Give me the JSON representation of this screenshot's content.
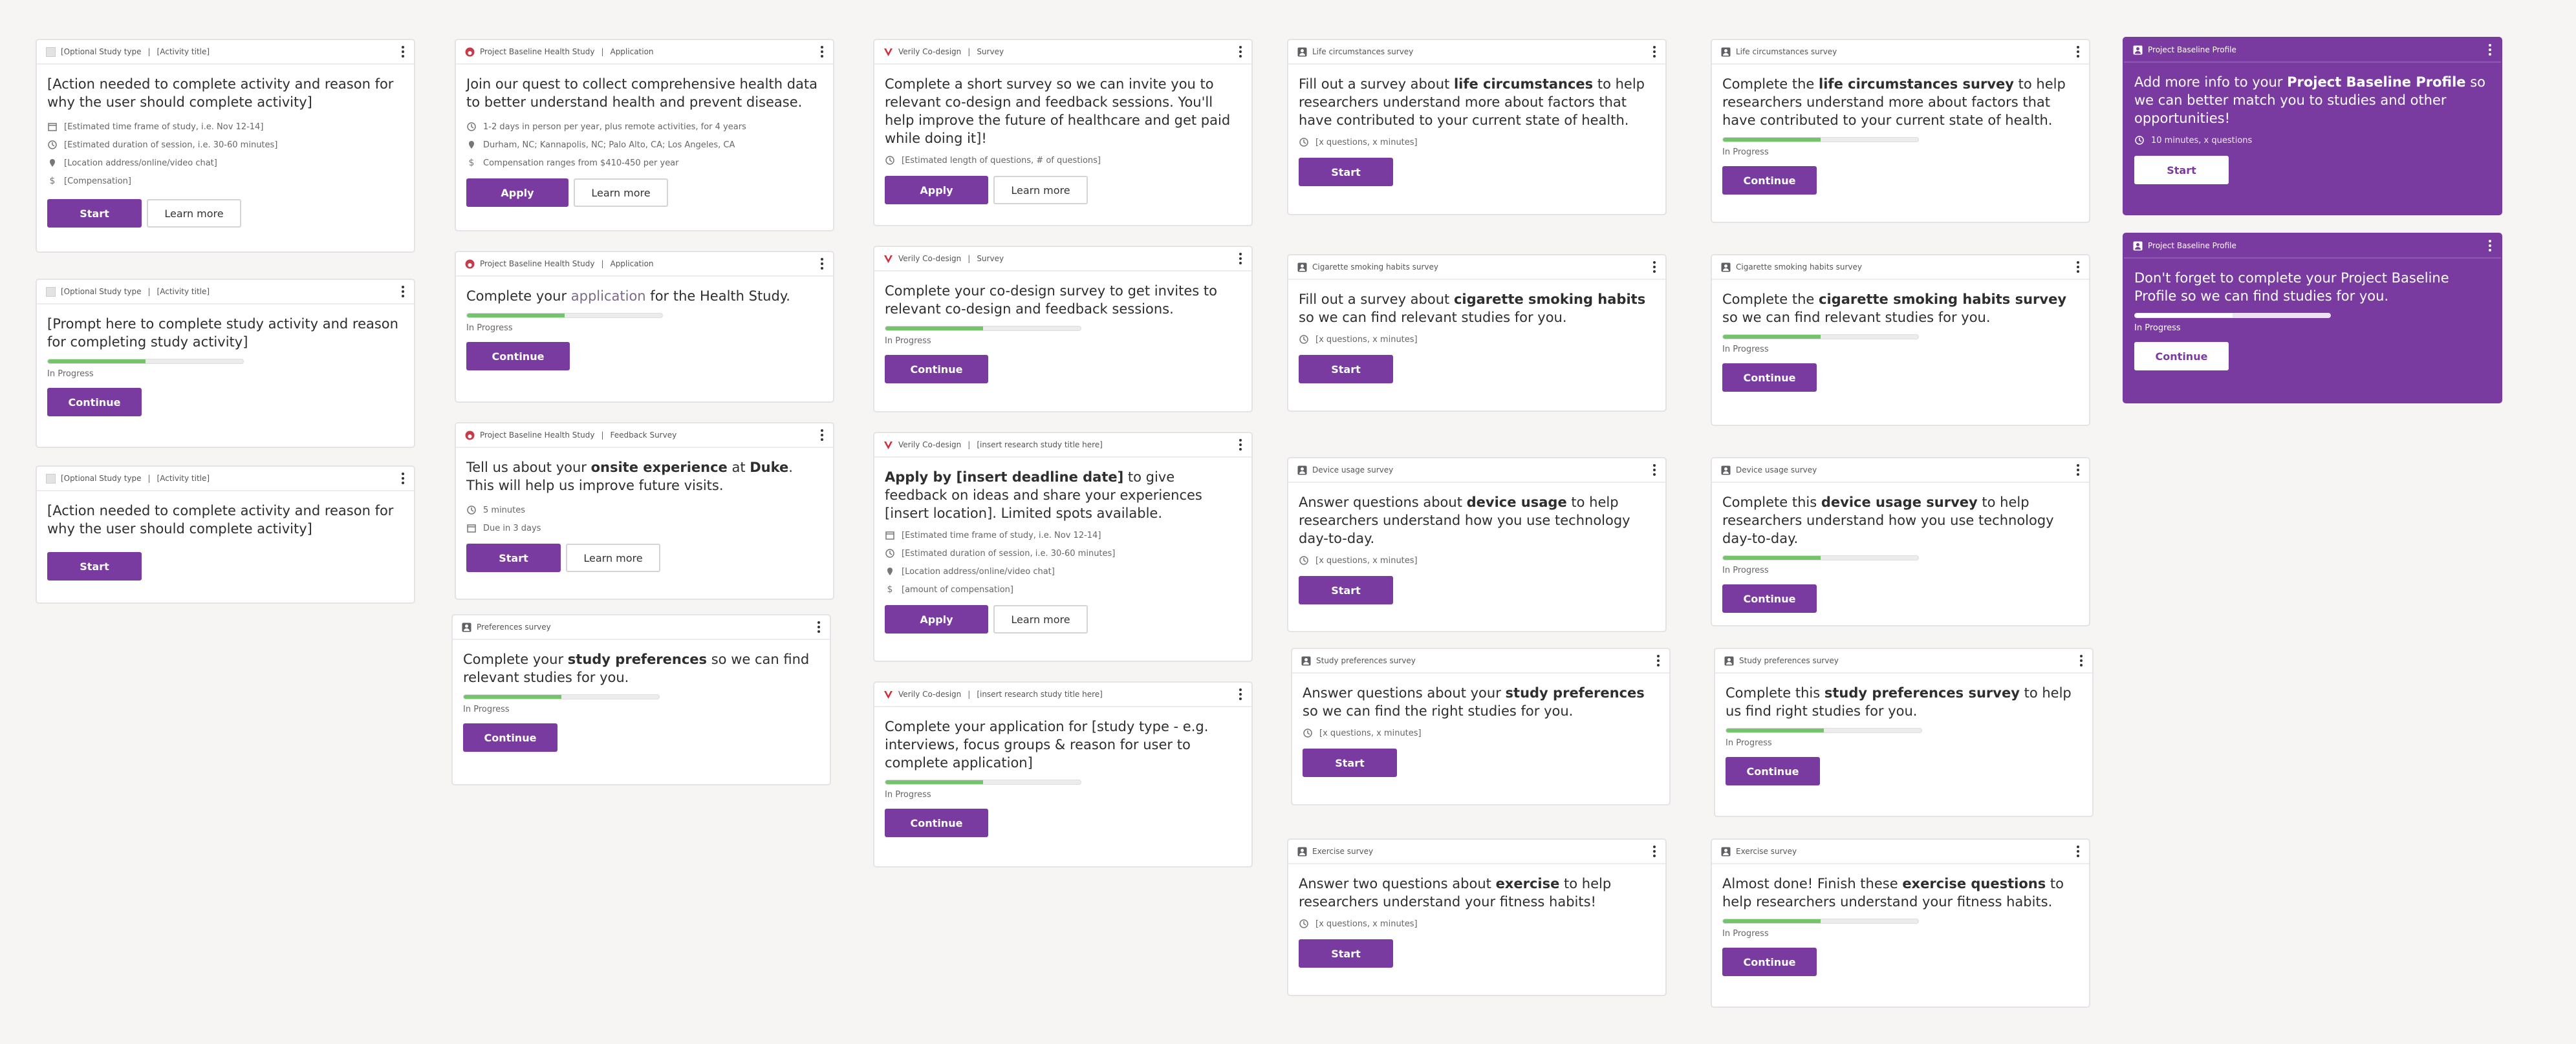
{
  "cards": [
    {
      "header": [
        "[Optional Study type",
        "[Activity title]"
      ],
      "title": "[Action needed to complete activity and reason for why the user should complete activity]",
      "meta": [
        "[Estimated time frame of study, i.e. Nov 12-14]",
        "[Estimated duration of session, i.e. 30-60 minutes]",
        "[Location address/online/video chat]",
        "[Compensation]"
      ],
      "buttons": [
        "Start",
        "Learn more"
      ]
    },
    {
      "header": [
        "[Optional Study type",
        "[Activity title]"
      ],
      "title": "[Prompt here to complete study activity and reason for completing study activity]",
      "progress_label": "In Progress",
      "progress": 0.5,
      "buttons": [
        "Continue"
      ]
    },
    {
      "header": [
        "[Optional Study type",
        "[Activity title]"
      ],
      "title": "[Action needed to complete activity and reason for why the user should complete activity]",
      "buttons": [
        "Start"
      ]
    },
    {
      "header": [
        "Project Baseline Health Study",
        "Application"
      ],
      "title": "Join our quest to collect comprehensive health data to better understand health and prevent disease.",
      "meta": [
        "1-2 days in person per year, plus remote activities, for 4 years",
        "Durham, NC; Kannapolis, NC; Palo Alto, CA; Los Angeles, CA",
        "Compensation ranges from $410-450 per year"
      ],
      "buttons": [
        "Apply",
        "Learn more"
      ]
    },
    {
      "header": [
        "Project Baseline Health Study",
        "Application"
      ],
      "title_parts": [
        "Complete your ",
        "application",
        " for the Health Study."
      ],
      "progress_label": "In Progress",
      "progress": 0.5,
      "buttons": [
        "Continue"
      ]
    },
    {
      "header": [
        "Project Baseline Health Study",
        "Feedback Survey"
      ],
      "title_parts": [
        "Tell us about your ",
        "onsite experience",
        " at ",
        "Duke",
        ". This will help us improve future visits."
      ],
      "meta": [
        "5 minutes",
        "Due in 3 days"
      ],
      "buttons": [
        "Start",
        "Learn more"
      ]
    },
    {
      "header": [
        "Preferences survey"
      ],
      "title_parts": [
        "Complete your ",
        "study preferences",
        " so we can find relevant studies for you."
      ],
      "progress_label": "In Progress",
      "progress": 0.5,
      "buttons": [
        "Continue"
      ]
    },
    {
      "header": [
        "Verily Co-design",
        "Survey"
      ],
      "title": "Complete a short survey so we can invite you to relevant co-design and feedback sessions. You'll help improve the future of healthcare and get paid while doing it]!",
      "meta": [
        "[Estimated length of questions, # of questions]"
      ],
      "buttons": [
        "Apply",
        "Learn more"
      ]
    },
    {
      "header": [
        "Verily Co-design",
        "Survey"
      ],
      "title": "Complete your co-design survey to get invites to relevant co-design and feedback sessions.",
      "progress_label": "In Progress",
      "progress": 0.5,
      "buttons": [
        "Continue"
      ]
    },
    {
      "header": [
        "Verily Co-design",
        "[insert research study title here]"
      ],
      "title_parts": [
        "Apply by [insert deadline date]",
        " to give feedback on ideas and share your experiences [insert location]. Limited spots available."
      ],
      "meta": [
        "[Estimated time frame of study, i.e. Nov 12-14]",
        "[Estimated duration of session, i.e. 30-60 minutes]",
        "[Location address/online/video chat]",
        "[amount of compensation]"
      ],
      "buttons": [
        "Apply",
        "Learn more"
      ]
    },
    {
      "header": [
        "Verily Co-design",
        "[insert research study title here]"
      ],
      "title": "Complete your application for [study type - e.g. interviews, focus groups & reason for user to complete application]",
      "progress_label": "In Progress",
      "progress": 0.5,
      "buttons": [
        "Continue"
      ]
    },
    {
      "header": [
        "Life circumstances survey"
      ],
      "title_parts": [
        "Fill out a survey about ",
        "life circumstances",
        " to help researchers understand more about factors that have contributed to your current state of health."
      ],
      "meta": [
        "[x questions, x minutes]"
      ],
      "buttons": [
        "Start"
      ]
    },
    {
      "header": [
        "Cigarette smoking habits survey"
      ],
      "title_parts": [
        "Fill out a survey about ",
        "cigarette smoking habits",
        " so we can find relevant studies for you."
      ],
      "meta": [
        "[x questions, x minutes]"
      ],
      "buttons": [
        "Start"
      ]
    },
    {
      "header": [
        "Device usage survey"
      ],
      "title_parts": [
        "Answer questions about ",
        "device usage",
        " to help researchers understand how you use technology day-to-day."
      ],
      "meta": [
        "[x questions, x minutes]"
      ],
      "buttons": [
        "Start"
      ]
    },
    {
      "header": [
        "Study preferences survey"
      ],
      "title_parts": [
        "Answer questions about your ",
        "study preferences",
        " so we can find the right studies for you."
      ],
      "meta": [
        "[x questions, x minutes]"
      ],
      "buttons": [
        "Start"
      ]
    },
    {
      "header": [
        "Exercise survey"
      ],
      "title_parts": [
        "Answer two questions about ",
        "exercise",
        " to help researchers understand your fitness habits!"
      ],
      "meta": [
        "[x questions, x minutes]"
      ],
      "buttons": [
        "Start"
      ]
    },
    {
      "header": [
        "Life circumstances survey"
      ],
      "title_parts": [
        "Complete the ",
        "life circumstances survey",
        " to help researchers understand more about factors that have contributed to your current state of health."
      ],
      "progress_label": "In Progress",
      "progress": 0.5,
      "buttons": [
        "Continue"
      ]
    },
    {
      "header": [
        "Cigarette smoking habits survey"
      ],
      "title_parts": [
        "Complete the ",
        "cigarette smoking habits survey",
        " so we can find relevant studies for you."
      ],
      "progress_label": "In Progress",
      "progress": 0.5,
      "buttons": [
        "Continue"
      ]
    },
    {
      "header": [
        "Device usage survey"
      ],
      "title_parts": [
        "Complete this ",
        "device usage survey",
        " to help researchers understand how you use technology day-to-day."
      ],
      "progress_label": "In Progress",
      "progress": 0.5,
      "buttons": [
        "Continue"
      ]
    },
    {
      "header": [
        "Study preferences survey"
      ],
      "title_parts": [
        "Complete this ",
        "study preferences survey",
        " to help us find right studies for you."
      ],
      "progress_label": "In Progress",
      "progress": 0.5,
      "buttons": [
        "Continue"
      ]
    },
    {
      "header": [
        "Exercise survey"
      ],
      "title_parts": [
        "Almost done! Finish these ",
        "exercise questions",
        " to help researchers understand your fitness habits."
      ],
      "progress_label": "In Progress",
      "progress": 0.5,
      "buttons": [
        "Continue"
      ]
    },
    {
      "header": [
        "Project Baseline Profile"
      ],
      "title_parts": [
        "Add more info to your ",
        "Project Baseline Profile",
        " so we can better match you to studies and other opportunities!"
      ],
      "meta": [
        "10 minutes, x questions"
      ],
      "buttons": [
        "Start"
      ]
    },
    {
      "header": [
        "Project Baseline Profile"
      ],
      "title": "Don't forget to complete your Project Baseline Profile so we can find studies for you.",
      "progress_label": "In Progress",
      "progress": 0.5,
      "buttons": [
        "Continue"
      ]
    }
  ],
  "colors": {
    "accent": "#7a3ba1",
    "progress": "#75c36d",
    "verily_red": "#d42b3c",
    "baseline_red": "#c8394a"
  }
}
